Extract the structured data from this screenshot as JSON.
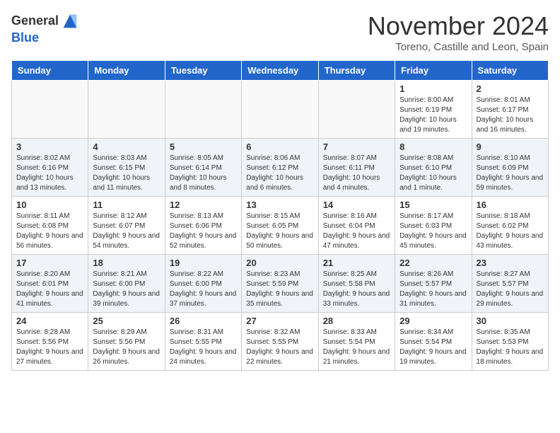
{
  "header": {
    "logo_line1": "General",
    "logo_line2": "Blue",
    "month": "November 2024",
    "location": "Toreno, Castille and Leon, Spain"
  },
  "days_of_week": [
    "Sunday",
    "Monday",
    "Tuesday",
    "Wednesday",
    "Thursday",
    "Friday",
    "Saturday"
  ],
  "weeks": [
    [
      {
        "day": "",
        "info": ""
      },
      {
        "day": "",
        "info": ""
      },
      {
        "day": "",
        "info": ""
      },
      {
        "day": "",
        "info": ""
      },
      {
        "day": "",
        "info": ""
      },
      {
        "day": "1",
        "info": "Sunrise: 8:00 AM\nSunset: 6:19 PM\nDaylight: 10 hours and 19 minutes."
      },
      {
        "day": "2",
        "info": "Sunrise: 8:01 AM\nSunset: 6:17 PM\nDaylight: 10 hours and 16 minutes."
      }
    ],
    [
      {
        "day": "3",
        "info": "Sunrise: 8:02 AM\nSunset: 6:16 PM\nDaylight: 10 hours and 13 minutes."
      },
      {
        "day": "4",
        "info": "Sunrise: 8:03 AM\nSunset: 6:15 PM\nDaylight: 10 hours and 11 minutes."
      },
      {
        "day": "5",
        "info": "Sunrise: 8:05 AM\nSunset: 6:14 PM\nDaylight: 10 hours and 8 minutes."
      },
      {
        "day": "6",
        "info": "Sunrise: 8:06 AM\nSunset: 6:12 PM\nDaylight: 10 hours and 6 minutes."
      },
      {
        "day": "7",
        "info": "Sunrise: 8:07 AM\nSunset: 6:11 PM\nDaylight: 10 hours and 4 minutes."
      },
      {
        "day": "8",
        "info": "Sunrise: 8:08 AM\nSunset: 6:10 PM\nDaylight: 10 hours and 1 minute."
      },
      {
        "day": "9",
        "info": "Sunrise: 8:10 AM\nSunset: 6:09 PM\nDaylight: 9 hours and 59 minutes."
      }
    ],
    [
      {
        "day": "10",
        "info": "Sunrise: 8:11 AM\nSunset: 6:08 PM\nDaylight: 9 hours and 56 minutes."
      },
      {
        "day": "11",
        "info": "Sunrise: 8:12 AM\nSunset: 6:07 PM\nDaylight: 9 hours and 54 minutes."
      },
      {
        "day": "12",
        "info": "Sunrise: 8:13 AM\nSunset: 6:06 PM\nDaylight: 9 hours and 52 minutes."
      },
      {
        "day": "13",
        "info": "Sunrise: 8:15 AM\nSunset: 6:05 PM\nDaylight: 9 hours and 50 minutes."
      },
      {
        "day": "14",
        "info": "Sunrise: 8:16 AM\nSunset: 6:04 PM\nDaylight: 9 hours and 47 minutes."
      },
      {
        "day": "15",
        "info": "Sunrise: 8:17 AM\nSunset: 6:03 PM\nDaylight: 9 hours and 45 minutes."
      },
      {
        "day": "16",
        "info": "Sunrise: 8:18 AM\nSunset: 6:02 PM\nDaylight: 9 hours and 43 minutes."
      }
    ],
    [
      {
        "day": "17",
        "info": "Sunrise: 8:20 AM\nSunset: 6:01 PM\nDaylight: 9 hours and 41 minutes."
      },
      {
        "day": "18",
        "info": "Sunrise: 8:21 AM\nSunset: 6:00 PM\nDaylight: 9 hours and 39 minutes."
      },
      {
        "day": "19",
        "info": "Sunrise: 8:22 AM\nSunset: 6:00 PM\nDaylight: 9 hours and 37 minutes."
      },
      {
        "day": "20",
        "info": "Sunrise: 8:23 AM\nSunset: 5:59 PM\nDaylight: 9 hours and 35 minutes."
      },
      {
        "day": "21",
        "info": "Sunrise: 8:25 AM\nSunset: 5:58 PM\nDaylight: 9 hours and 33 minutes."
      },
      {
        "day": "22",
        "info": "Sunrise: 8:26 AM\nSunset: 5:57 PM\nDaylight: 9 hours and 31 minutes."
      },
      {
        "day": "23",
        "info": "Sunrise: 8:27 AM\nSunset: 5:57 PM\nDaylight: 9 hours and 29 minutes."
      }
    ],
    [
      {
        "day": "24",
        "info": "Sunrise: 8:28 AM\nSunset: 5:56 PM\nDaylight: 9 hours and 27 minutes."
      },
      {
        "day": "25",
        "info": "Sunrise: 8:29 AM\nSunset: 5:56 PM\nDaylight: 9 hours and 26 minutes."
      },
      {
        "day": "26",
        "info": "Sunrise: 8:31 AM\nSunset: 5:55 PM\nDaylight: 9 hours and 24 minutes."
      },
      {
        "day": "27",
        "info": "Sunrise: 8:32 AM\nSunset: 5:55 PM\nDaylight: 9 hours and 22 minutes."
      },
      {
        "day": "28",
        "info": "Sunrise: 8:33 AM\nSunset: 5:54 PM\nDaylight: 9 hours and 21 minutes."
      },
      {
        "day": "29",
        "info": "Sunrise: 8:34 AM\nSunset: 5:54 PM\nDaylight: 9 hours and 19 minutes."
      },
      {
        "day": "30",
        "info": "Sunrise: 8:35 AM\nSunset: 5:53 PM\nDaylight: 9 hours and 18 minutes."
      }
    ]
  ]
}
